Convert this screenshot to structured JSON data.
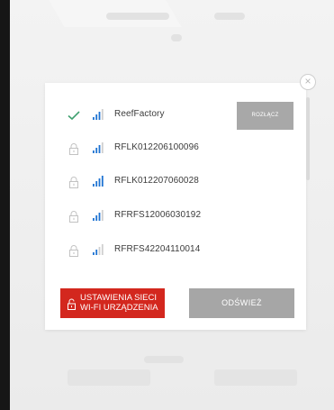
{
  "modal": {
    "close_icon": "close-icon",
    "networks": [
      {
        "ssid": "ReefFactory",
        "status": "connected",
        "signal_bars": 3
      },
      {
        "ssid": "RFLK012206100096",
        "status": "locked",
        "signal_bars": 3
      },
      {
        "ssid": "RFLK012207060028",
        "status": "locked",
        "signal_bars": 4
      },
      {
        "ssid": "RFRFS12006030192",
        "status": "locked",
        "signal_bars": 3
      },
      {
        "ssid": "RFRFS42204110014",
        "status": "locked",
        "signal_bars": 2
      }
    ],
    "disconnect_label": "ROZŁĄCZ",
    "settings_label_1": "USTAWIENIA SIECI",
    "settings_label_2": "WI-FI URZĄDZENIA",
    "refresh_label": "ODŚWIEŻ"
  },
  "colors": {
    "accent_red": "#d3271e",
    "connected_green": "#3fa06f",
    "signal_blue": "#1e73d2",
    "signal_inactive": "#cfcfcf",
    "button_gray": "#a6a6a6"
  }
}
